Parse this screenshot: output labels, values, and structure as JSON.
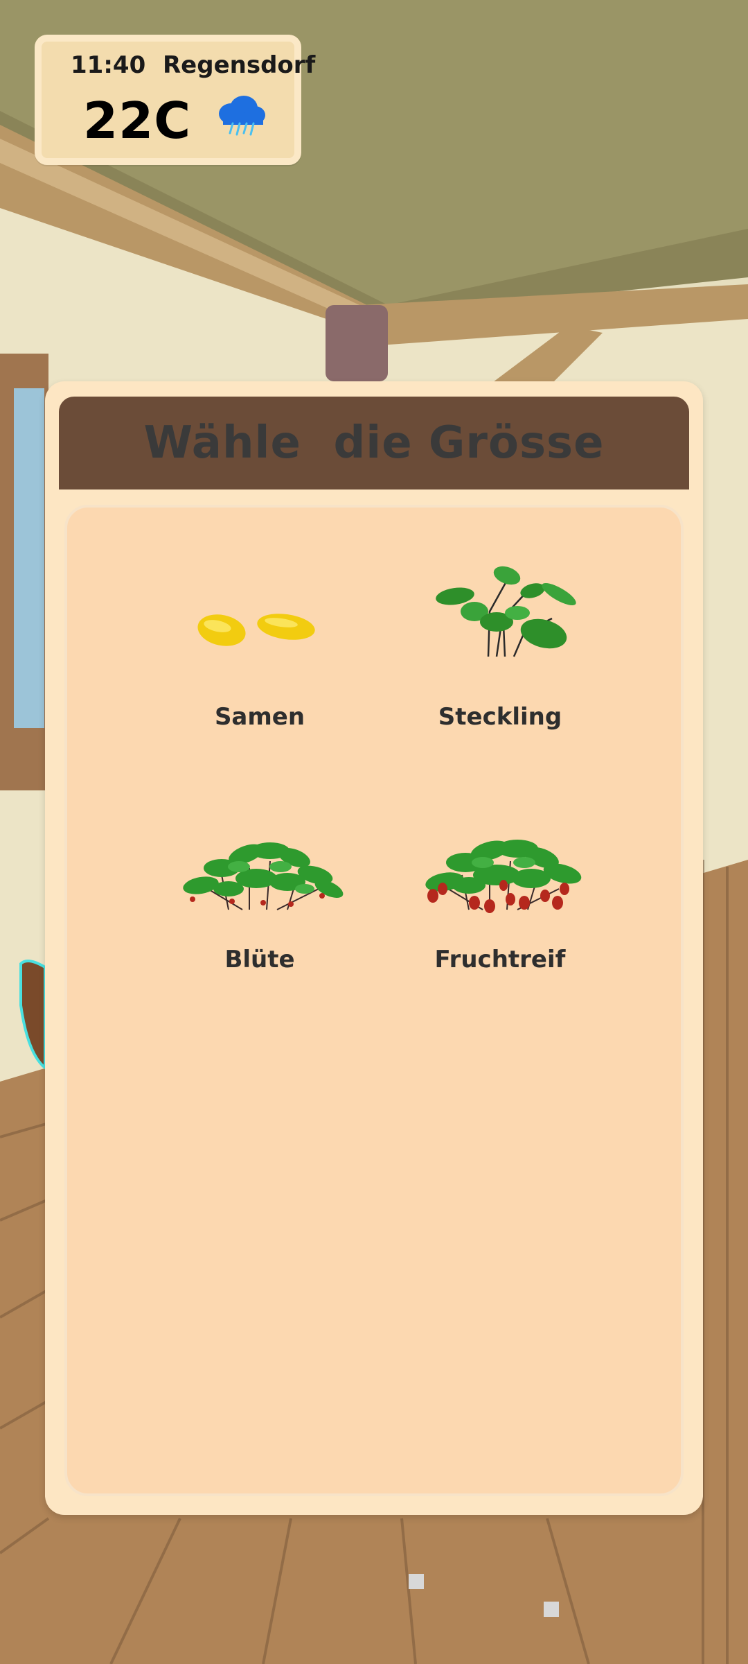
{
  "status": {
    "time": "11:40",
    "city": "Regensdorf",
    "temperature": "22C",
    "weather_icon": "rain-cloud-icon"
  },
  "dialog": {
    "title": "Wähle  die Grösse",
    "options": [
      {
        "label": "Samen",
        "icon": "seeds-icon"
      },
      {
        "label": "Steckling",
        "icon": "seedling-icon"
      },
      {
        "label": "Blüte",
        "icon": "flowering-plant-icon"
      },
      {
        "label": "Fruchtreif",
        "icon": "fruiting-plant-icon"
      }
    ]
  },
  "colors": {
    "header": "#6b4c38",
    "panel": "#fde6c3",
    "panel_inner": "#fcd8b0",
    "leaf": "#2f9a2f",
    "berry": "#b5281d"
  }
}
